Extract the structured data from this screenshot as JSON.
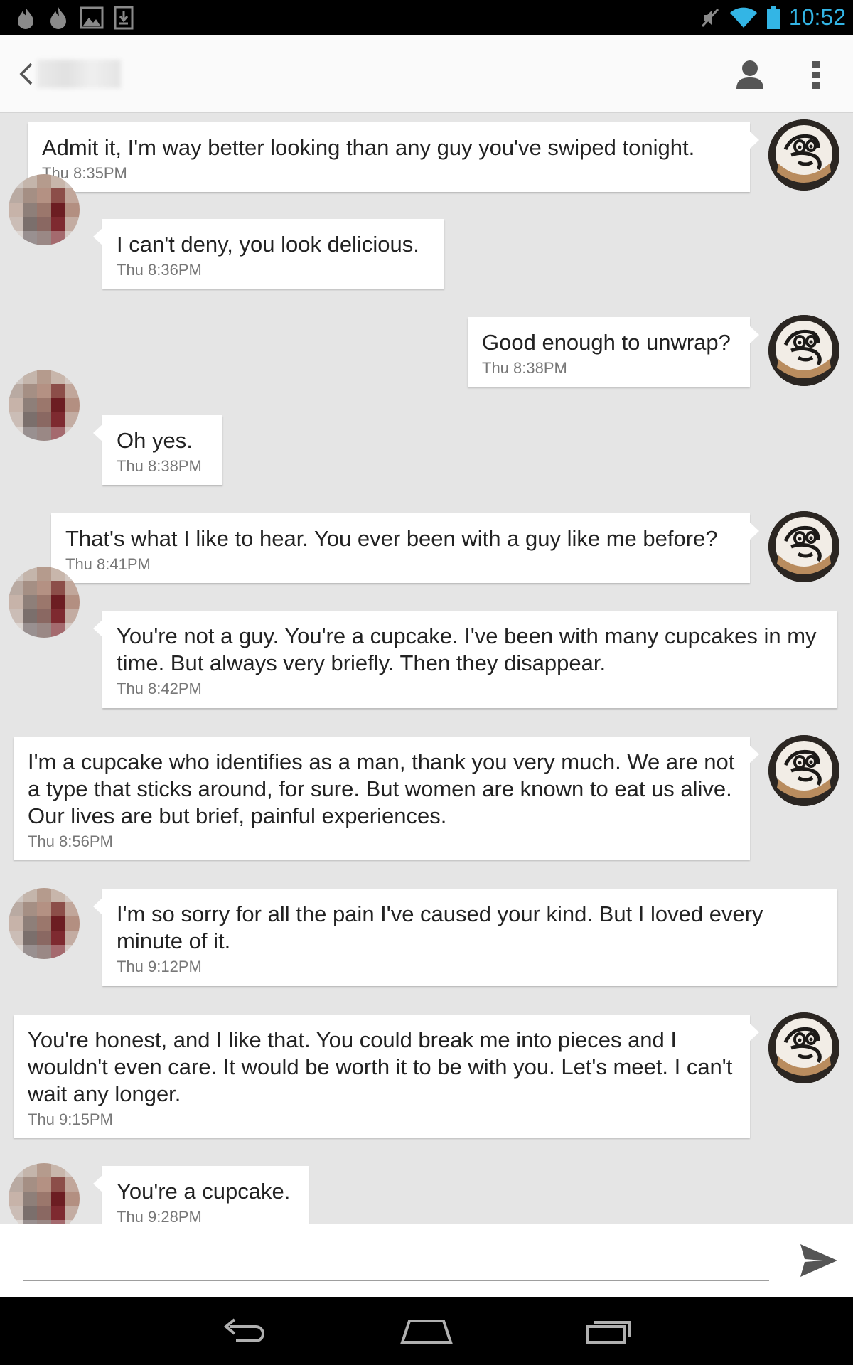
{
  "status_bar": {
    "time": "10:52",
    "left_icons": [
      "flame-icon",
      "flame-icon",
      "image-icon",
      "download-icon"
    ],
    "right_icons": [
      "mute-icon",
      "wifi-icon",
      "battery-icon"
    ],
    "accent_color": "#33b5e5"
  },
  "header": {
    "contact_name": "",
    "icons": [
      "back-arrow-icon",
      "profile-icon",
      "overflow-menu-icon"
    ]
  },
  "messages": [
    {
      "side": "out",
      "text": "Admit it, I'm way better looking than any guy you've swiped tonight.",
      "time": "Thu 8:35PM"
    },
    {
      "side": "in",
      "text": "I can't deny, you look delicious.",
      "time": "Thu 8:36PM"
    },
    {
      "side": "out",
      "text": "Good enough to unwrap?",
      "time": "Thu 8:38PM"
    },
    {
      "side": "in",
      "text": "Oh yes.",
      "time": "Thu 8:38PM"
    },
    {
      "side": "out",
      "text": "That's what I like to hear. You ever been with a guy like me before?",
      "time": "Thu 8:41PM"
    },
    {
      "side": "in",
      "text": "You're not a guy. You're a cupcake. I've been with many cupcakes in my time. But always very briefly. Then they disappear.",
      "time": "Thu 8:42PM"
    },
    {
      "side": "out",
      "text": "I'm a cupcake who identifies as a man, thank you very much. We are not a type that sticks around, for sure. But women are known to eat us alive. Our lives are but brief, painful experiences.",
      "time": "Thu 8:56PM"
    },
    {
      "side": "in",
      "text": "I'm so sorry for all the pain I've caused your kind. But I loved every minute of it.",
      "time": "Thu 9:12PM"
    },
    {
      "side": "out",
      "text": "You're honest, and I like that. You could break me into pieces and I wouldn't even care. It would be worth it to be with you. Let's meet. I can't wait any longer.",
      "time": "Thu 9:15PM"
    },
    {
      "side": "in",
      "text": "You're a cupcake.",
      "time": "Thu 9:28PM"
    }
  ],
  "composer": {
    "value": "",
    "placeholder": "",
    "send_icon": "send-icon"
  },
  "nav_bar": {
    "icons": [
      "back-icon",
      "home-icon",
      "recent-apps-icon"
    ]
  }
}
